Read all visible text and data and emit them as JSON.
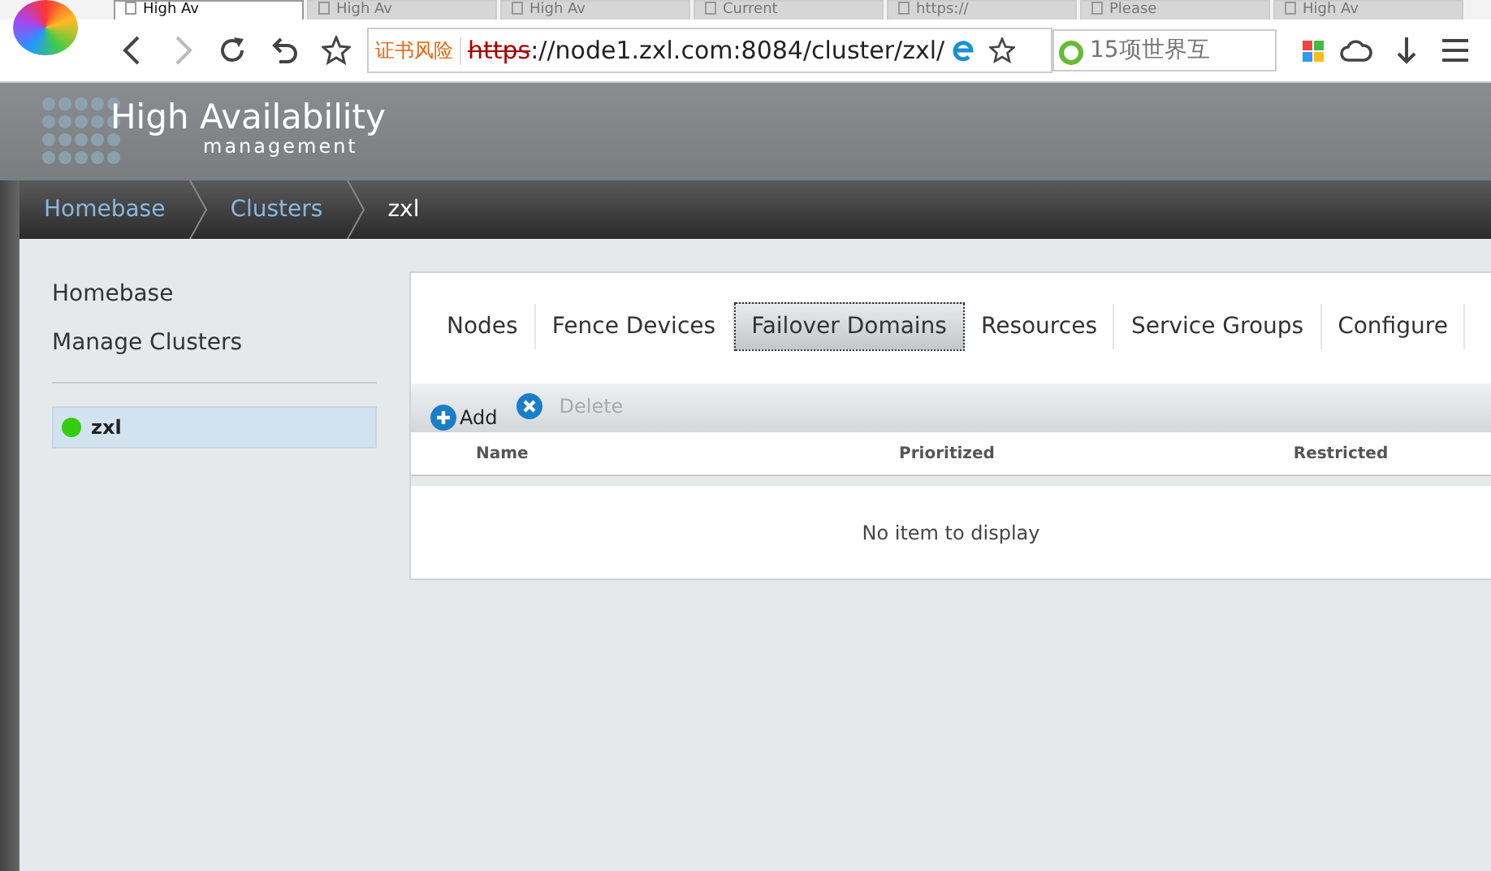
{
  "browser": {
    "tabs": [
      {
        "label": "High Av",
        "selected": true
      },
      {
        "label": "High Av",
        "selected": false
      },
      {
        "label": "High Av",
        "selected": false
      },
      {
        "label": "Current",
        "selected": false
      },
      {
        "label": "https://",
        "selected": false
      },
      {
        "label": "Please",
        "selected": false
      },
      {
        "label": "High Av",
        "selected": false
      }
    ],
    "cert_warning": "证书风险",
    "url_struck": "https",
    "url_rest": "://node1.zxl.com:8084/cluster/zxl/",
    "search_placeholder": "15项世界互"
  },
  "app": {
    "title": "High Availability",
    "subtitle": "management"
  },
  "breadcrumb": [
    {
      "label": "Homebase",
      "current": false
    },
    {
      "label": "Clusters",
      "current": false
    },
    {
      "label": "zxl",
      "current": true
    }
  ],
  "sidebar": {
    "links": [
      "Homebase",
      "Manage Clusters"
    ],
    "clusters": [
      {
        "name": "zxl",
        "color": "#33cc11",
        "selected": true
      }
    ]
  },
  "tabs": [
    {
      "label": "Nodes",
      "selected": false
    },
    {
      "label": "Fence Devices",
      "selected": false
    },
    {
      "label": "Failover Domains",
      "selected": true
    },
    {
      "label": "Resources",
      "selected": false
    },
    {
      "label": "Service Groups",
      "selected": false
    },
    {
      "label": "Configure",
      "selected": false
    }
  ],
  "toolbar": [
    {
      "label": "Add",
      "kind": "add",
      "disabled": false
    },
    {
      "label": "Delete",
      "kind": "delete",
      "disabled": true
    }
  ],
  "table": {
    "columns": [
      "Name",
      "Prioritized",
      "Restricted"
    ],
    "empty_text": "No item to display"
  }
}
